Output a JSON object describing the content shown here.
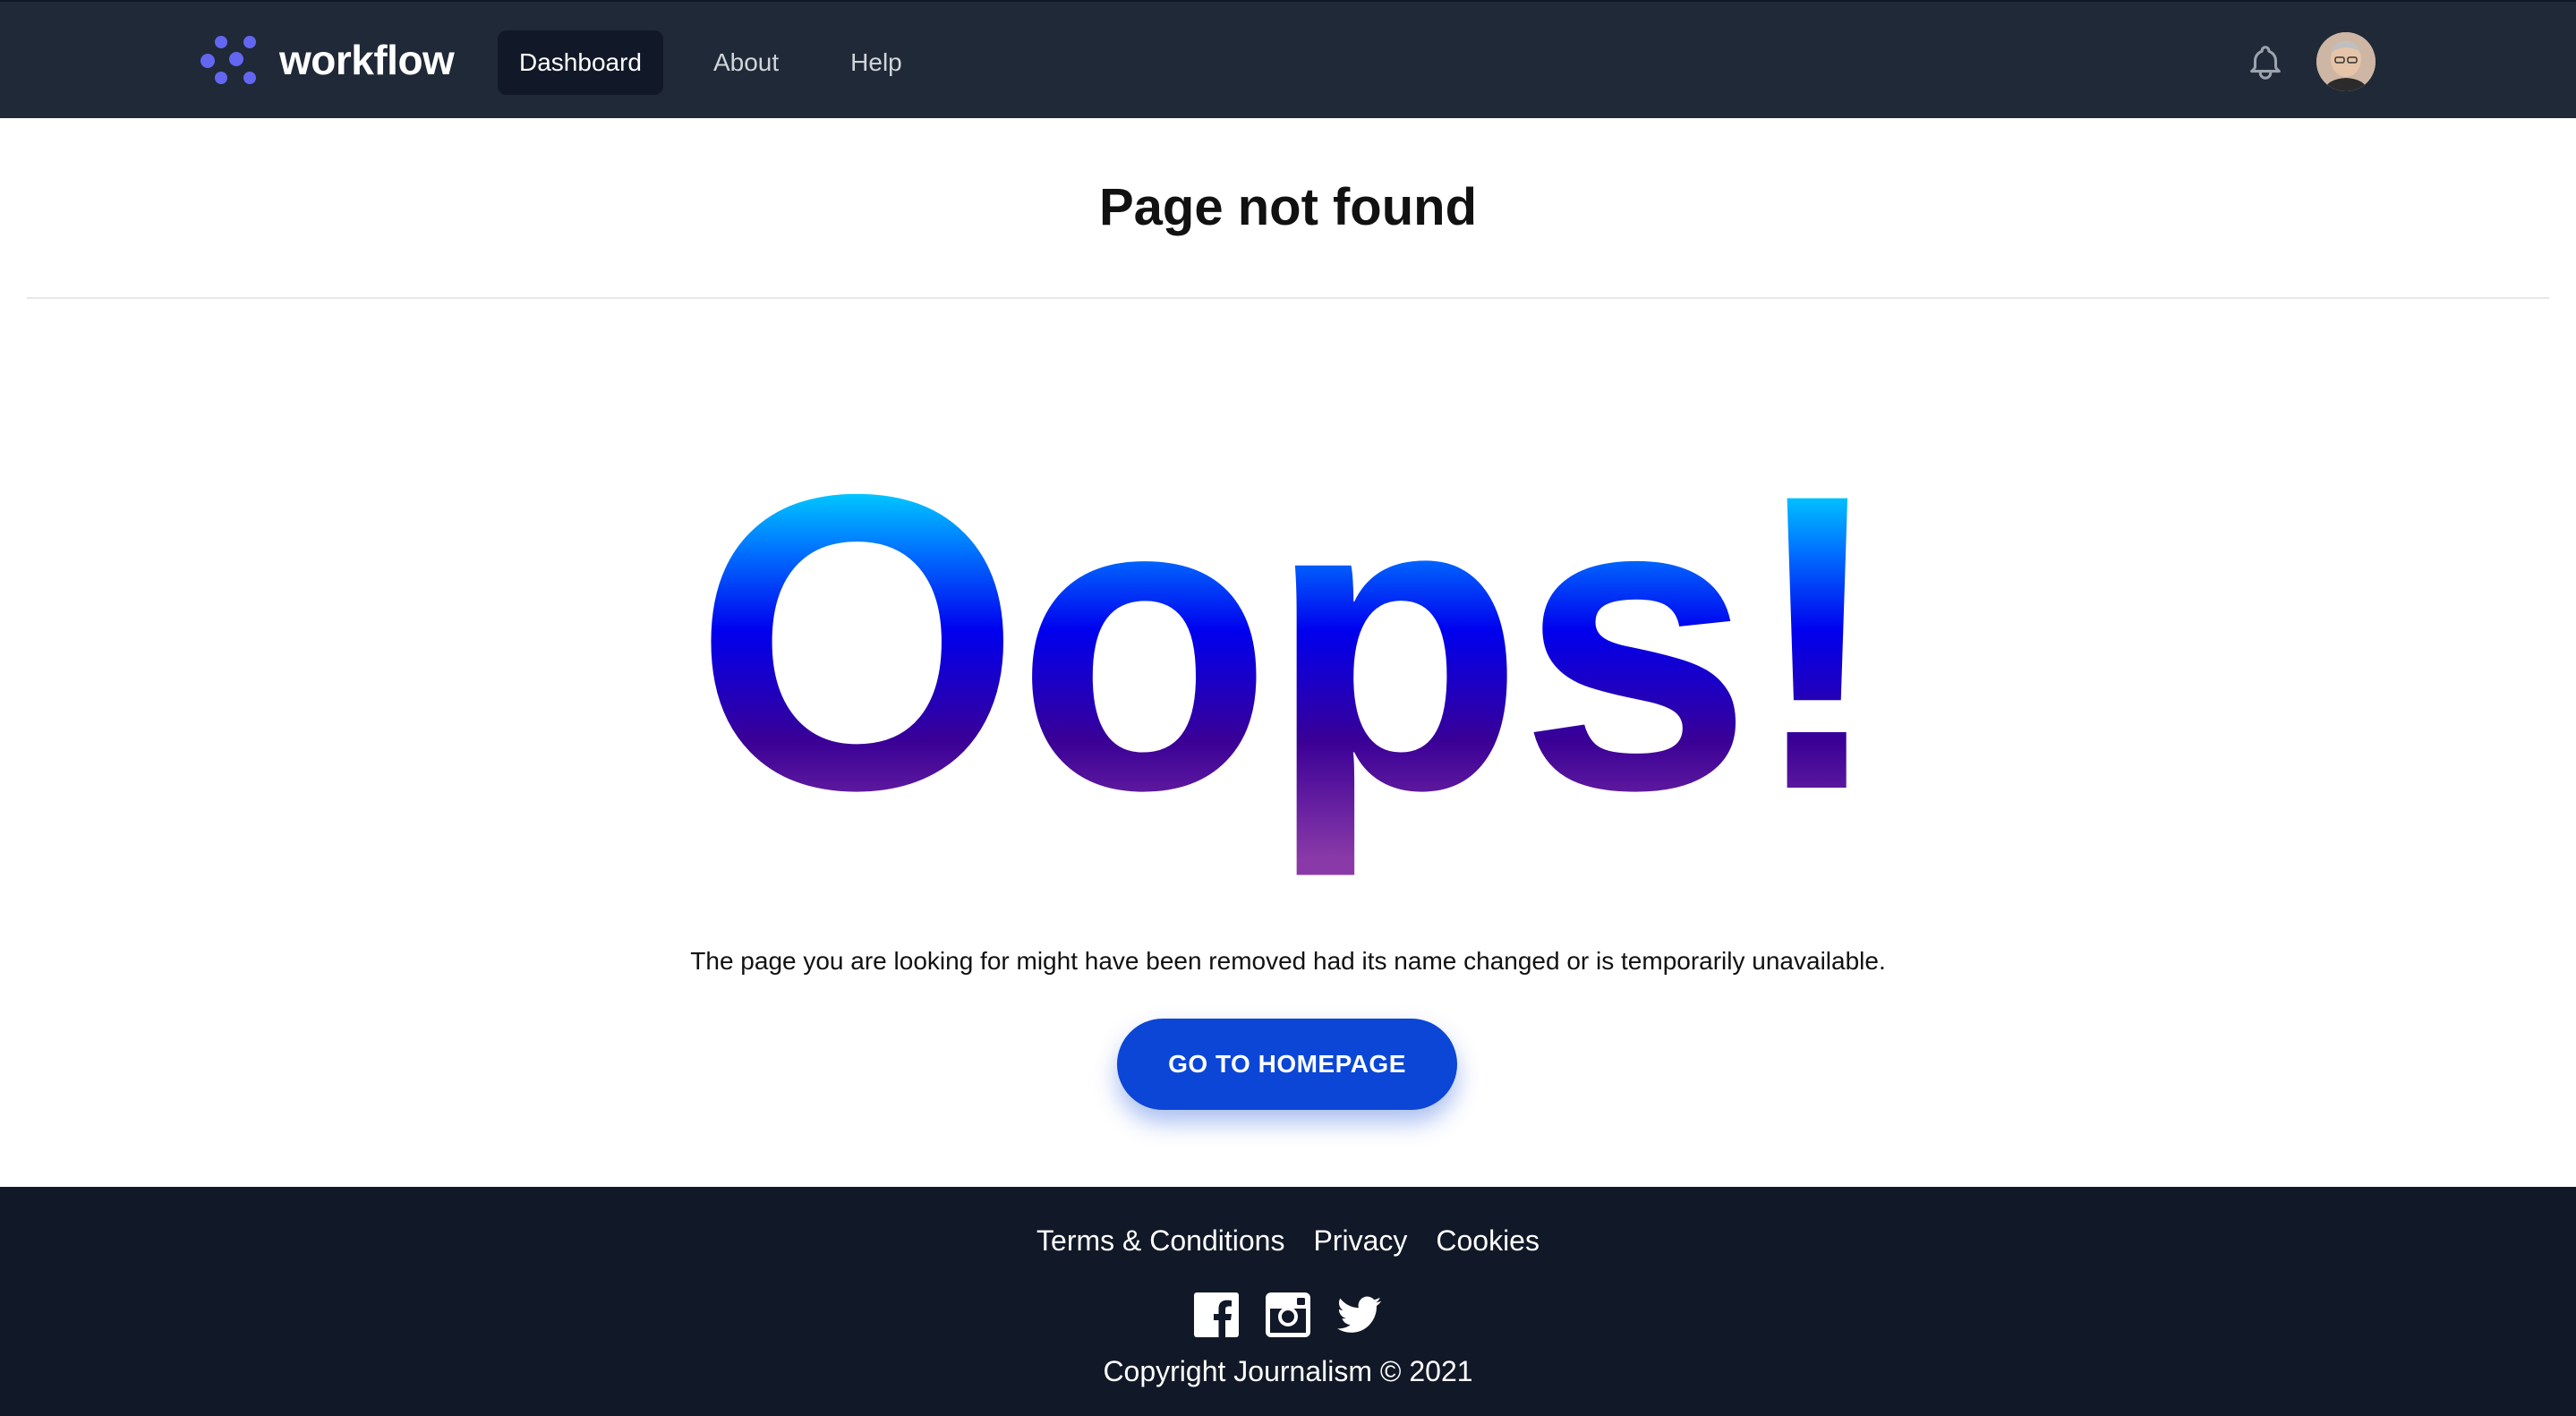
{
  "navbar": {
    "brand": "workflow",
    "links": [
      {
        "label": "Dashboard",
        "active": true
      },
      {
        "label": "About",
        "active": false
      },
      {
        "label": "Help",
        "active": false
      }
    ],
    "icons": {
      "notifications": "bell-icon",
      "profile": "user-avatar"
    }
  },
  "header": {
    "title": "Page not found"
  },
  "error": {
    "headline": "Oops!",
    "message": "The page you are looking for might have been removed had its name changed or is temporarily unavailable.",
    "cta_label": "GO TO HOMEPAGE"
  },
  "footer": {
    "links": [
      "Terms & Conditions",
      "Privacy",
      "Cookies"
    ],
    "social": [
      "facebook-icon",
      "instagram-icon",
      "twitter-icon"
    ],
    "copyright": "Copyright Journalism © 2021"
  },
  "colors": {
    "navbar_bg": "#1f2937",
    "footer_bg": "#111827",
    "accent": "#6366f1",
    "button": "#0b46d6",
    "gradient_top": "#00f0ff",
    "gradient_mid": "#0000ee",
    "gradient_bottom": "#8a3aa8"
  }
}
